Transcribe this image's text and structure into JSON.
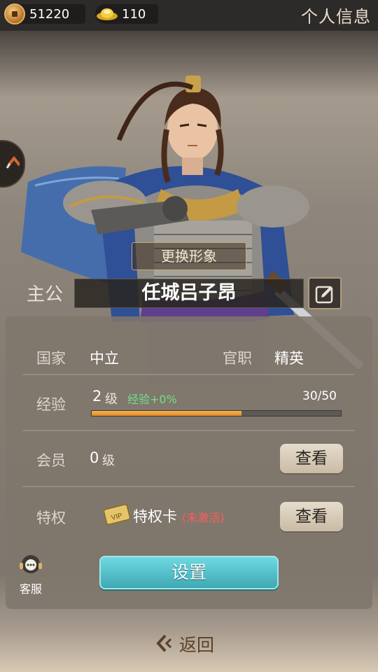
{
  "topbar": {
    "coins": "51220",
    "gold": "110",
    "title": "个人信息",
    "icons": {
      "coins": "copper-coin-icon",
      "gold": "gold-ingot-icon"
    }
  },
  "hero": {
    "change_look": "更换形象",
    "lord_label": "主公",
    "name": "任城吕子昂"
  },
  "info": {
    "country_label": "国家",
    "country_value": "中立",
    "official_label": "官职",
    "official_value": "精英",
    "exp_label": "经验",
    "level": "2",
    "level_unit": "级",
    "exp_bonus": "经验+0%",
    "exp_count": "30/50",
    "exp_progress": 0.6,
    "member_label": "会员",
    "member_level": "0",
    "member_unit": "级",
    "view_button": "查看",
    "privilege_label": "特权",
    "vip_text": "VIP",
    "privilege_card": "特权卡",
    "privilege_status": "(未激活)",
    "settings": "设置",
    "customer_service": "客服"
  },
  "footer": {
    "back": "返回"
  },
  "colors": {
    "accent_teal": "#4fbcc6",
    "exp_orange": "#f0a13a",
    "bonus_green": "#6fe08a",
    "inactive_red": "#ff5a5a"
  }
}
